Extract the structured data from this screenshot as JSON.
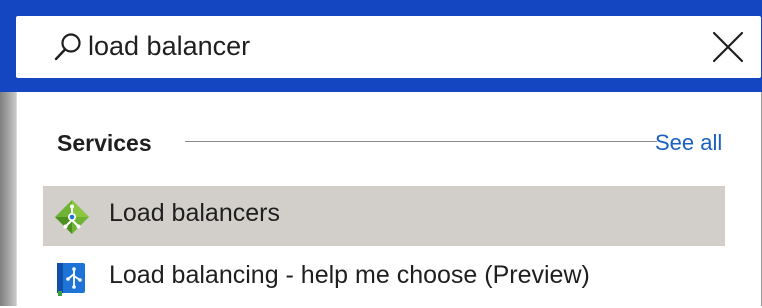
{
  "search": {
    "value": "load balancer",
    "icon": "search-icon",
    "clear_icon": "close-icon"
  },
  "dropdown": {
    "section_title": "Services",
    "see_all_label": "See all",
    "results": [
      {
        "label": "Load balancers",
        "icon": "load-balancer-icon",
        "highlighted": true
      },
      {
        "label": "Load balancing - help me choose (Preview)",
        "icon": "load-balancing-guide-icon",
        "highlighted": false
      }
    ]
  },
  "colors": {
    "topbar": "#1546c2",
    "link": "#1b5fc0",
    "row_highlight": "#d2cfcb"
  }
}
